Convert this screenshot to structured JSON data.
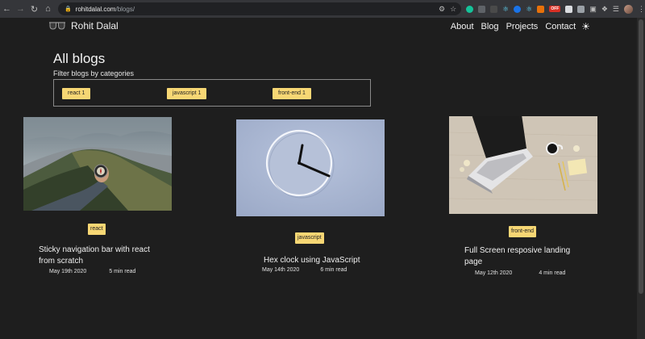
{
  "browser": {
    "url_host": "rohitdalal.com",
    "url_path": "/blogs/",
    "badge_text": "OFF"
  },
  "site": {
    "brand_name": "Rohit Dalal",
    "nav": [
      "About",
      "Blog",
      "Projects",
      "Contact"
    ],
    "theme_icon": "sun-icon"
  },
  "blogs_page": {
    "title": "All blogs",
    "filter_label": "Filter blogs by categories",
    "categories": [
      {
        "label": "react 1"
      },
      {
        "label": "javascript 1"
      },
      {
        "label": "front-end 1"
      }
    ]
  },
  "posts": [
    {
      "tag": "react",
      "title": "Sticky navigation bar with react from scratch",
      "date": "May 19th 2020",
      "read_time": "5 min read",
      "image": "mountain-compass-photo"
    },
    {
      "tag": "javascript",
      "title": "Hex clock using JavaScript",
      "date": "May 14th 2020",
      "read_time": "6 min read",
      "image": "wall-clock-photo"
    },
    {
      "tag": "front-end",
      "title": "Full Screen resposive landing page",
      "date": "May 12th 2020",
      "read_time": "4 min read",
      "image": "laptop-desk-photo"
    }
  ],
  "colors": {
    "background": "#1e1e1e",
    "accent_yellow": "#f7d774",
    "text": "#f0f0f0"
  }
}
